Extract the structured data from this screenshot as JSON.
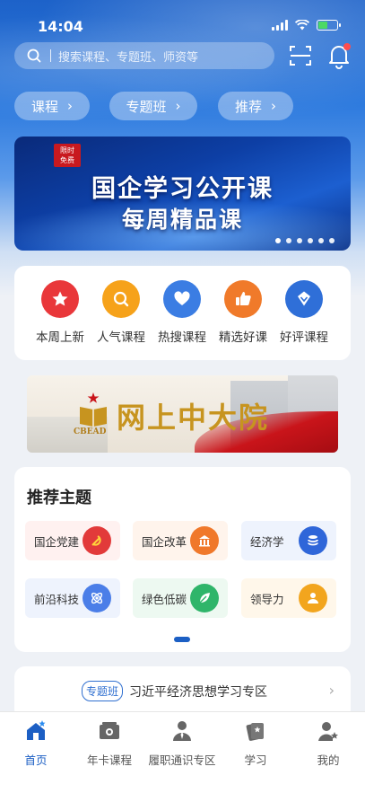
{
  "status": {
    "time": "14:04"
  },
  "search": {
    "placeholder": "搜索课程、专题班、师资等"
  },
  "categories": [
    {
      "label": "课程"
    },
    {
      "label": "专题班"
    },
    {
      "label": "推荐"
    }
  ],
  "banner": {
    "tag_line1": "限时",
    "tag_line2": "免费",
    "title_line1": "国企学习公开课",
    "title_line2": "每周精品课",
    "slide_count": 6,
    "active_slide": 1
  },
  "quick_links": [
    {
      "label": "本周上新",
      "icon": "star-icon",
      "color": "#e9373a"
    },
    {
      "label": "人气课程",
      "icon": "search-icon",
      "color": "#f6a21a"
    },
    {
      "label": "热搜课程",
      "icon": "heart-icon",
      "color": "#3b7de3"
    },
    {
      "label": "精选好课",
      "icon": "thumbs-up-icon",
      "color": "#f07a2a"
    },
    {
      "label": "好评课程",
      "icon": "diamond-icon",
      "color": "#2f6fd8"
    }
  ],
  "promo": {
    "title": "网上中大院",
    "logo_text": "CBEAD"
  },
  "topics": {
    "heading": "推荐主题",
    "items": [
      {
        "label": "国企党建",
        "icon": "party-emblem-icon",
        "color": "#e23a3a",
        "bg": "#fff1f0"
      },
      {
        "label": "国企改革",
        "icon": "building-icon",
        "color": "#f0782a",
        "bg": "#fff4ec"
      },
      {
        "label": "经济学",
        "icon": "coins-icon",
        "color": "#2f66d9",
        "bg": "#eef3fd"
      },
      {
        "label": "前沿科技",
        "icon": "atom-icon",
        "color": "#4b7ee8",
        "bg": "#eef3fd"
      },
      {
        "label": "绿色低碳",
        "icon": "leaf-icon",
        "color": "#2fb56a",
        "bg": "#edf9f1"
      },
      {
        "label": "领导力",
        "icon": "person-icon",
        "color": "#f2a51e",
        "bg": "#fff7ea"
      }
    ]
  },
  "special": {
    "badge": "专题班",
    "title": "习近平经济思想学习专区"
  },
  "tabs": [
    {
      "label": "首页",
      "icon": "home-icon",
      "active": true
    },
    {
      "label": "年卡课程",
      "icon": "card-icon",
      "active": false
    },
    {
      "label": "履职通识专区",
      "icon": "user-tie-icon",
      "active": false
    },
    {
      "label": "学习",
      "icon": "books-icon",
      "active": false
    },
    {
      "label": "我的",
      "icon": "profile-icon",
      "active": false
    }
  ],
  "colors": {
    "accent": "#1c5fc4",
    "hero_top": "#1d62c9"
  }
}
